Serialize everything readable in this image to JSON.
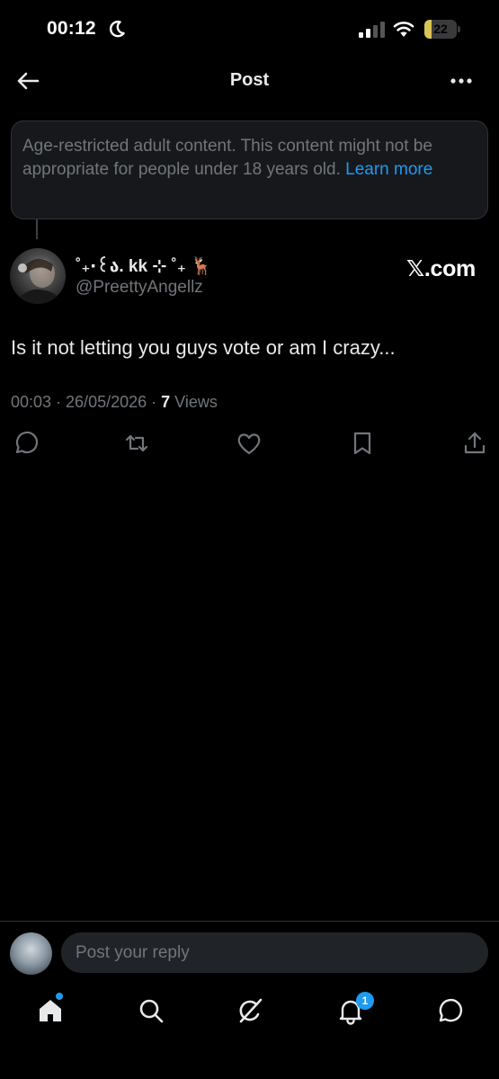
{
  "status_bar": {
    "time": "00:12",
    "battery_level": "22",
    "battery_fraction": 0.22
  },
  "header": {
    "title": "Post"
  },
  "notice": {
    "text": "Age-restricted adult content. This content might not be appropriate for people under 18 years old.",
    "link": "Learn more"
  },
  "post": {
    "display_name": "˚₊‧꒰ა. kk ⊹ ˚₊ 🦌",
    "handle": "@PreettyAngellz",
    "source": "𝕏.com",
    "text": "Is it not letting you guys vote or am I crazy...",
    "timestamp": "00:03 · 26/05/2026 · ",
    "views_count": "7",
    "views_label": " Views"
  },
  "actions": [
    "reply-icon",
    "repost-icon",
    "like-icon",
    "bookmark-icon",
    "share-icon"
  ],
  "reply": {
    "placeholder": "Post your reply"
  },
  "nav": {
    "items": [
      "home-icon",
      "search-icon",
      "grok-icon",
      "notifications-icon",
      "messages-icon"
    ],
    "notification_count": "1"
  },
  "colors": {
    "accent": "#1d9bf0",
    "background": "#000000",
    "secondary_text": "#71767b"
  }
}
